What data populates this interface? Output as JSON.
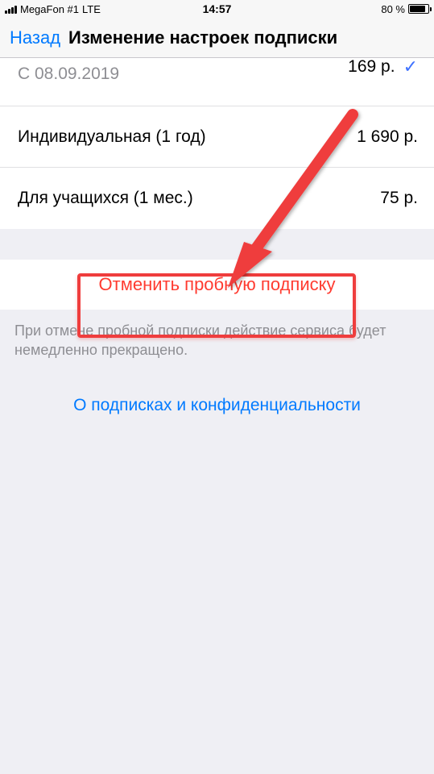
{
  "statusbar": {
    "carrier": "MegaFon #1",
    "network": "LTE",
    "time": "14:57",
    "battery_percent": "80 %"
  },
  "nav": {
    "back": "Назад",
    "title": "Изменение настроек подписки"
  },
  "plans": {
    "current": {
      "sub": "С 08.09.2019",
      "price": "169 р."
    },
    "yearly": {
      "label": "Индивидуальная (1 год)",
      "price": "1 690 р."
    },
    "student": {
      "label": "Для учащихся (1 мес.)",
      "price": "75 р."
    }
  },
  "cancel": {
    "label": "Отменить пробную подписку"
  },
  "footer": {
    "note": "При отмене пробной подписки действие сервиса будет немедленно прекращено."
  },
  "privacy": {
    "label": "О подписках и конфиденциальности"
  }
}
